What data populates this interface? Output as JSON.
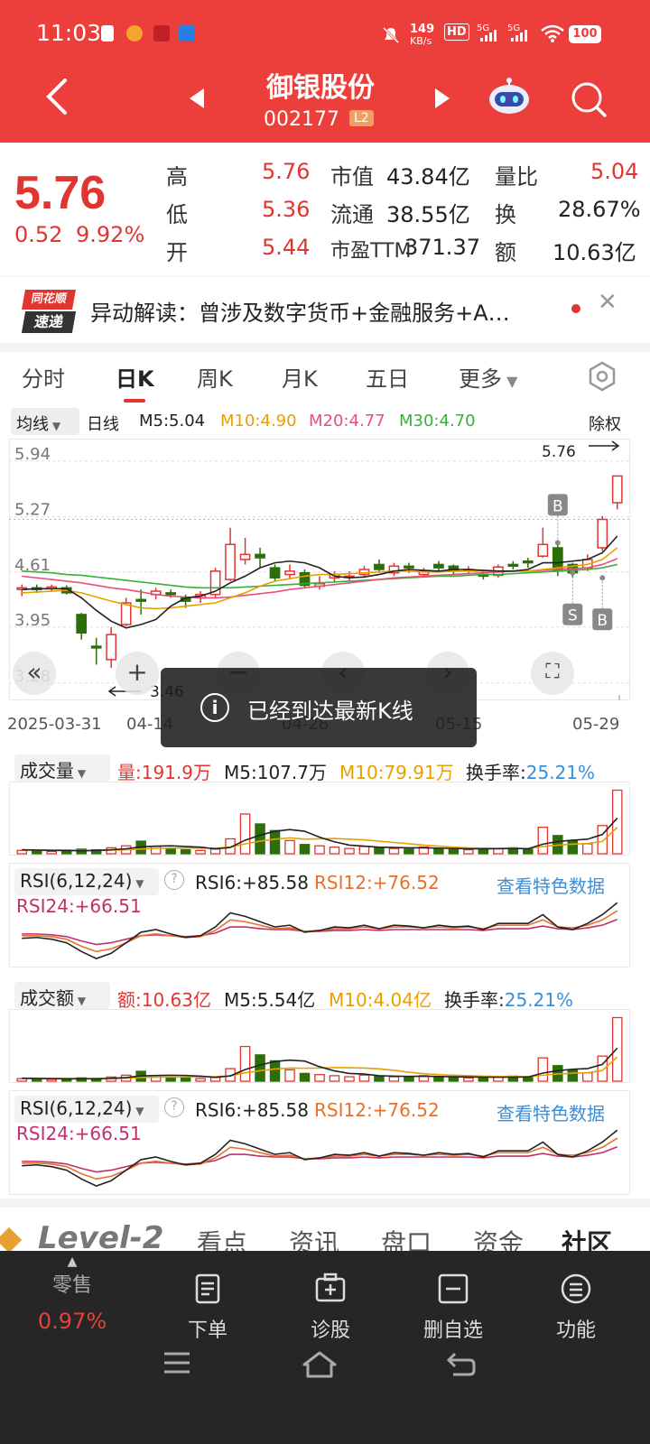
{
  "status_bar": {
    "time": "11:03",
    "net_speed": "149",
    "net_unit": "KB/s",
    "battery": "100"
  },
  "header": {
    "name": "御银股份",
    "code": "002177",
    "badge": "L2"
  },
  "quote": {
    "price": "5.76",
    "change": "0.52",
    "change_pct": "9.92%",
    "rows": [
      {
        "l1": "高",
        "v1": "5.76",
        "l2": "市值",
        "v2": "43.84亿",
        "l3": "量比",
        "v3": "5.04"
      },
      {
        "l1": "低",
        "v1": "5.36",
        "l2": "流通",
        "v2": "38.55亿",
        "l3": "换",
        "v3": "28.67%"
      },
      {
        "l1": "开",
        "v1": "5.44",
        "l2": "市盈TTM",
        "v2": "371.37",
        "l3": "额",
        "v3": "10.63亿"
      }
    ]
  },
  "news": {
    "logo_top": "同花顺",
    "logo_bottom": "速递",
    "text": "异动解读：曾涉及数字货币+金融服务+A…"
  },
  "tabs": [
    "分时",
    "日K",
    "周K",
    "月K",
    "五日",
    "更多"
  ],
  "ma_legend": {
    "selector": "均线",
    "type": "日线",
    "adj": "除权",
    "m5": "M5:5.04",
    "m10": "M10:4.90",
    "m20": "M20:4.77",
    "m30": "M30:4.70"
  },
  "kline": {
    "y_ticks": [
      "5.94",
      "5.27",
      "4.61",
      "3.95",
      "3.28"
    ],
    "x_ticks": [
      "2025-03-31",
      "04-14",
      "04-28",
      "05-15",
      "05-29"
    ],
    "high_label": "5.76",
    "low_label": "3.46",
    "marks": {
      "b": "B",
      "s": "S"
    }
  },
  "volume": {
    "selector": "成交量",
    "value": "量:191.9万",
    "m5": "M5:107.7万",
    "m10": "M10:79.91万",
    "turnover_label": "换手率:",
    "turnover": "25.21%"
  },
  "rsi1": {
    "selector": "RSI(6,12,24)",
    "rsi6": "RSI6:+85.58",
    "rsi12": "RSI12:+76.52",
    "rsi24": "RSI24:+66.51",
    "link": "查看特色数据"
  },
  "amount": {
    "selector": "成交额",
    "value": "额:10.63亿",
    "m5": "M5:5.54亿",
    "m10": "M10:4.04亿",
    "turnover_label": "换手率:",
    "turnover": "25.21%"
  },
  "rsi2": {
    "selector": "RSI(6,12,24)",
    "rsi6": "RSI6:+85.58",
    "rsi12": "RSI12:+76.52",
    "rsi24": "RSI24:+66.51",
    "link": "查看特色数据"
  },
  "toast": {
    "text": "已经到达最新K线"
  },
  "l2strip": {
    "logo": "Level-2",
    "tabs": [
      "看点",
      "资讯",
      "盘口",
      "资金",
      "社区"
    ]
  },
  "bottom": {
    "retail_label": "零售",
    "retail_value": "0.97%",
    "items": [
      "下单",
      "诊股",
      "删自选",
      "功能"
    ]
  },
  "colors": {
    "up": "#e03530",
    "down": "#2e6e0a",
    "header": "#ec3e3b",
    "m5": "#222222",
    "m10": "#e8a000",
    "m20": "#e8507a",
    "m30": "#38b03a",
    "link": "#3a8fd8"
  },
  "chart_data": {
    "type": "candlestick",
    "days": [
      {
        "o": 4.4,
        "c": 4.42,
        "h": 4.46,
        "l": 4.32
      },
      {
        "o": 4.42,
        "c": 4.4,
        "h": 4.46,
        "l": 4.36
      },
      {
        "o": 4.41,
        "c": 4.43,
        "h": 4.46,
        "l": 4.38
      },
      {
        "o": 4.42,
        "c": 4.36,
        "h": 4.45,
        "l": 4.34
      },
      {
        "o": 4.1,
        "c": 3.88,
        "h": 4.12,
        "l": 3.8
      },
      {
        "o": 3.72,
        "c": 3.7,
        "h": 3.82,
        "l": 3.5
      },
      {
        "o": 3.56,
        "c": 3.86,
        "h": 3.95,
        "l": 3.46
      },
      {
        "o": 3.98,
        "c": 4.24,
        "h": 4.3,
        "l": 3.96
      },
      {
        "o": 4.28,
        "c": 4.26,
        "h": 4.4,
        "l": 4.1
      },
      {
        "o": 4.34,
        "c": 4.38,
        "h": 4.42,
        "l": 4.28
      },
      {
        "o": 4.36,
        "c": 4.34,
        "h": 4.4,
        "l": 4.3
      },
      {
        "o": 4.3,
        "c": 4.26,
        "h": 4.34,
        "l": 4.18
      },
      {
        "o": 4.3,
        "c": 4.34,
        "h": 4.38,
        "l": 4.24
      },
      {
        "o": 4.34,
        "c": 4.62,
        "h": 4.66,
        "l": 4.3
      },
      {
        "o": 4.52,
        "c": 4.94,
        "h": 5.14,
        "l": 4.5
      },
      {
        "o": 4.76,
        "c": 4.82,
        "h": 5.02,
        "l": 4.7
      },
      {
        "o": 4.82,
        "c": 4.78,
        "h": 4.9,
        "l": 4.66
      },
      {
        "o": 4.66,
        "c": 4.54,
        "h": 4.7,
        "l": 4.5
      },
      {
        "o": 4.58,
        "c": 4.62,
        "h": 4.7,
        "l": 4.52
      },
      {
        "o": 4.6,
        "c": 4.45,
        "h": 4.64,
        "l": 4.42
      },
      {
        "o": 4.44,
        "c": 4.47,
        "h": 4.56,
        "l": 4.4
      },
      {
        "o": 4.54,
        "c": 4.58,
        "h": 4.62,
        "l": 4.48
      },
      {
        "o": 4.56,
        "c": 4.56,
        "h": 4.62,
        "l": 4.5
      },
      {
        "o": 4.58,
        "c": 4.64,
        "h": 4.68,
        "l": 4.54
      },
      {
        "o": 4.7,
        "c": 4.64,
        "h": 4.76,
        "l": 4.6
      },
      {
        "o": 4.6,
        "c": 4.68,
        "h": 4.72,
        "l": 4.56
      },
      {
        "o": 4.68,
        "c": 4.66,
        "h": 4.72,
        "l": 4.6
      },
      {
        "o": 4.58,
        "c": 4.62,
        "h": 4.66,
        "l": 4.54
      },
      {
        "o": 4.7,
        "c": 4.66,
        "h": 4.74,
        "l": 4.62
      },
      {
        "o": 4.68,
        "c": 4.62,
        "h": 4.7,
        "l": 4.58
      },
      {
        "o": 4.64,
        "c": 4.64,
        "h": 4.68,
        "l": 4.58
      },
      {
        "o": 4.58,
        "c": 4.56,
        "h": 4.62,
        "l": 4.52
      },
      {
        "o": 4.57,
        "c": 4.67,
        "h": 4.7,
        "l": 4.54
      },
      {
        "o": 4.7,
        "c": 4.68,
        "h": 4.74,
        "l": 4.64
      },
      {
        "o": 4.74,
        "c": 4.72,
        "h": 4.78,
        "l": 4.66
      },
      {
        "o": 4.8,
        "c": 4.94,
        "h": 5.14,
        "l": 4.78
      },
      {
        "o": 4.9,
        "c": 4.62,
        "h": 4.96,
        "l": 4.56
      },
      {
        "o": 4.7,
        "c": 4.6,
        "h": 4.72,
        "l": 4.54
      },
      {
        "o": 4.66,
        "c": 4.76,
        "h": 4.82,
        "l": 4.62
      },
      {
        "o": 4.9,
        "c": 5.24,
        "h": 5.28,
        "l": 4.86
      },
      {
        "o": 5.44,
        "c": 5.76,
        "h": 5.76,
        "l": 5.36
      }
    ],
    "ma5": [
      4.4,
      4.41,
      4.41,
      4.41,
      4.3,
      4.15,
      4.02,
      3.94,
      3.98,
      4.04,
      4.2,
      4.3,
      4.32,
      4.38,
      4.48,
      4.56,
      4.66,
      4.72,
      4.74,
      4.72,
      4.66,
      4.56,
      4.54,
      4.55,
      4.58,
      4.62,
      4.64,
      4.63,
      4.62,
      4.64,
      4.64,
      4.63,
      4.62,
      4.62,
      4.64,
      4.72,
      4.72,
      4.74,
      4.76,
      4.84,
      5.04
    ],
    "ma10": [
      4.36,
      4.37,
      4.38,
      4.39,
      4.36,
      4.31,
      4.26,
      4.22,
      4.18,
      4.17,
      4.18,
      4.2,
      4.22,
      4.24,
      4.3,
      4.36,
      4.44,
      4.5,
      4.53,
      4.56,
      4.58,
      4.58,
      4.59,
      4.6,
      4.61,
      4.62,
      4.62,
      4.61,
      4.61,
      4.62,
      4.62,
      4.62,
      4.62,
      4.62,
      4.62,
      4.64,
      4.66,
      4.68,
      4.7,
      4.76,
      4.9
    ],
    "ma20": [
      4.56,
      4.54,
      4.52,
      4.5,
      4.48,
      4.45,
      4.42,
      4.4,
      4.37,
      4.34,
      4.32,
      4.31,
      4.3,
      4.3,
      4.31,
      4.33,
      4.35,
      4.37,
      4.4,
      4.42,
      4.44,
      4.46,
      4.48,
      4.5,
      4.52,
      4.54,
      4.55,
      4.56,
      4.57,
      4.58,
      4.59,
      4.6,
      4.61,
      4.62,
      4.62,
      4.63,
      4.64,
      4.65,
      4.66,
      4.7,
      4.77
    ],
    "ma30": [
      4.62,
      4.61,
      4.6,
      4.58,
      4.57,
      4.55,
      4.53,
      4.51,
      4.49,
      4.47,
      4.45,
      4.43,
      4.42,
      4.42,
      4.42,
      4.43,
      4.44,
      4.45,
      4.46,
      4.47,
      4.48,
      4.49,
      4.5,
      4.51,
      4.52,
      4.53,
      4.54,
      4.55,
      4.56,
      4.56,
      4.57,
      4.58,
      4.58,
      4.59,
      4.6,
      4.61,
      4.62,
      4.63,
      4.64,
      4.66,
      4.7
    ],
    "volume_wan": [
      10,
      8,
      7,
      8,
      14,
      12,
      18,
      24,
      38,
      22,
      16,
      12,
      10,
      14,
      45,
      120,
      90,
      70,
      40,
      28,
      24,
      20,
      16,
      22,
      18,
      16,
      14,
      20,
      16,
      14,
      12,
      14,
      16,
      18,
      16,
      80,
      55,
      40,
      30,
      85,
      191.9
    ],
    "vol_ma5": [
      12,
      11,
      10,
      10,
      9,
      10,
      12,
      15,
      21,
      23,
      24,
      22,
      20,
      15,
      19,
      41,
      56,
      68,
      73,
      68,
      50,
      36,
      26,
      23,
      20,
      19,
      18,
      18,
      17,
      16,
      15,
      15,
      15,
      16,
      15,
      29,
      37,
      41,
      44,
      58,
      107.7
    ],
    "vol_ma10": [
      11,
      11,
      11,
      11,
      10,
      10,
      11,
      12,
      14,
      16,
      17,
      17,
      17,
      17,
      20,
      30,
      38,
      44,
      48,
      44,
      45,
      46,
      44,
      42,
      38,
      34,
      30,
      26,
      23,
      20,
      18,
      17,
      17,
      17,
      16,
      22,
      26,
      29,
      31,
      37,
      79.91
    ],
    "rsi6": [
      45,
      46,
      44,
      40,
      30,
      22,
      28,
      40,
      52,
      55,
      50,
      46,
      48,
      58,
      74,
      70,
      64,
      58,
      60,
      52,
      54,
      58,
      57,
      60,
      56,
      60,
      59,
      57,
      60,
      58,
      59,
      55,
      62,
      62,
      62,
      72,
      58,
      55,
      62,
      72,
      85.58
    ],
    "rsi12": [
      48,
      48,
      47,
      44,
      36,
      30,
      33,
      40,
      48,
      50,
      48,
      46,
      47,
      54,
      66,
      64,
      60,
      56,
      57,
      53,
      54,
      56,
      56,
      58,
      56,
      58,
      58,
      57,
      58,
      57,
      58,
      56,
      60,
      60,
      60,
      66,
      58,
      57,
      60,
      66,
      76.52
    ],
    "rsi24": [
      50,
      50,
      49,
      47,
      42,
      38,
      40,
      44,
      48,
      49,
      48,
      47,
      48,
      51,
      58,
      58,
      56,
      55,
      55,
      53,
      53,
      54,
      54,
      55,
      54,
      55,
      55,
      55,
      55,
      55,
      55,
      54,
      56,
      56,
      56,
      59,
      56,
      55,
      57,
      60,
      66.51
    ],
    "amount_yi": [
      0.44,
      0.35,
      0.31,
      0.35,
      0.55,
      0.45,
      0.7,
      1.0,
      1.65,
      0.95,
      0.7,
      0.52,
      0.44,
      0.62,
      2.1,
      5.8,
      4.4,
      3.4,
      1.9,
      1.3,
      1.1,
      0.92,
      0.74,
      1.02,
      0.84,
      0.74,
      0.66,
      0.92,
      0.74,
      0.66,
      0.56,
      0.64,
      0.74,
      0.84,
      0.74,
      3.9,
      2.6,
      1.86,
      1.4,
      4.2,
      10.63
    ],
    "amt_ma5": [
      0.5,
      0.46,
      0.42,
      0.4,
      0.4,
      0.4,
      0.47,
      0.61,
      0.87,
      0.95,
      1.0,
      0.96,
      0.85,
      0.65,
      0.88,
      1.94,
      2.7,
      3.3,
      3.52,
      3.36,
      2.42,
      1.72,
      1.29,
      1.2,
      0.92,
      0.85,
      0.8,
      0.84,
      0.78,
      0.74,
      0.71,
      0.68,
      0.66,
      0.68,
      0.7,
      1.36,
      1.76,
      2.0,
      2.1,
      2.8,
      5.54
    ],
    "amt_ma10": [
      0.46,
      0.46,
      0.45,
      0.44,
      0.43,
      0.43,
      0.45,
      0.5,
      0.63,
      0.67,
      0.7,
      0.71,
      0.73,
      0.75,
      0.9,
      1.4,
      1.75,
      2.04,
      2.2,
      2.17,
      2.2,
      2.28,
      2.26,
      2.2,
      2.06,
      1.82,
      1.5,
      1.26,
      1.1,
      1.0,
      0.92,
      0.84,
      0.8,
      0.78,
      0.74,
      1.0,
      1.22,
      1.34,
      1.4,
      1.78,
      4.04
    ]
  }
}
